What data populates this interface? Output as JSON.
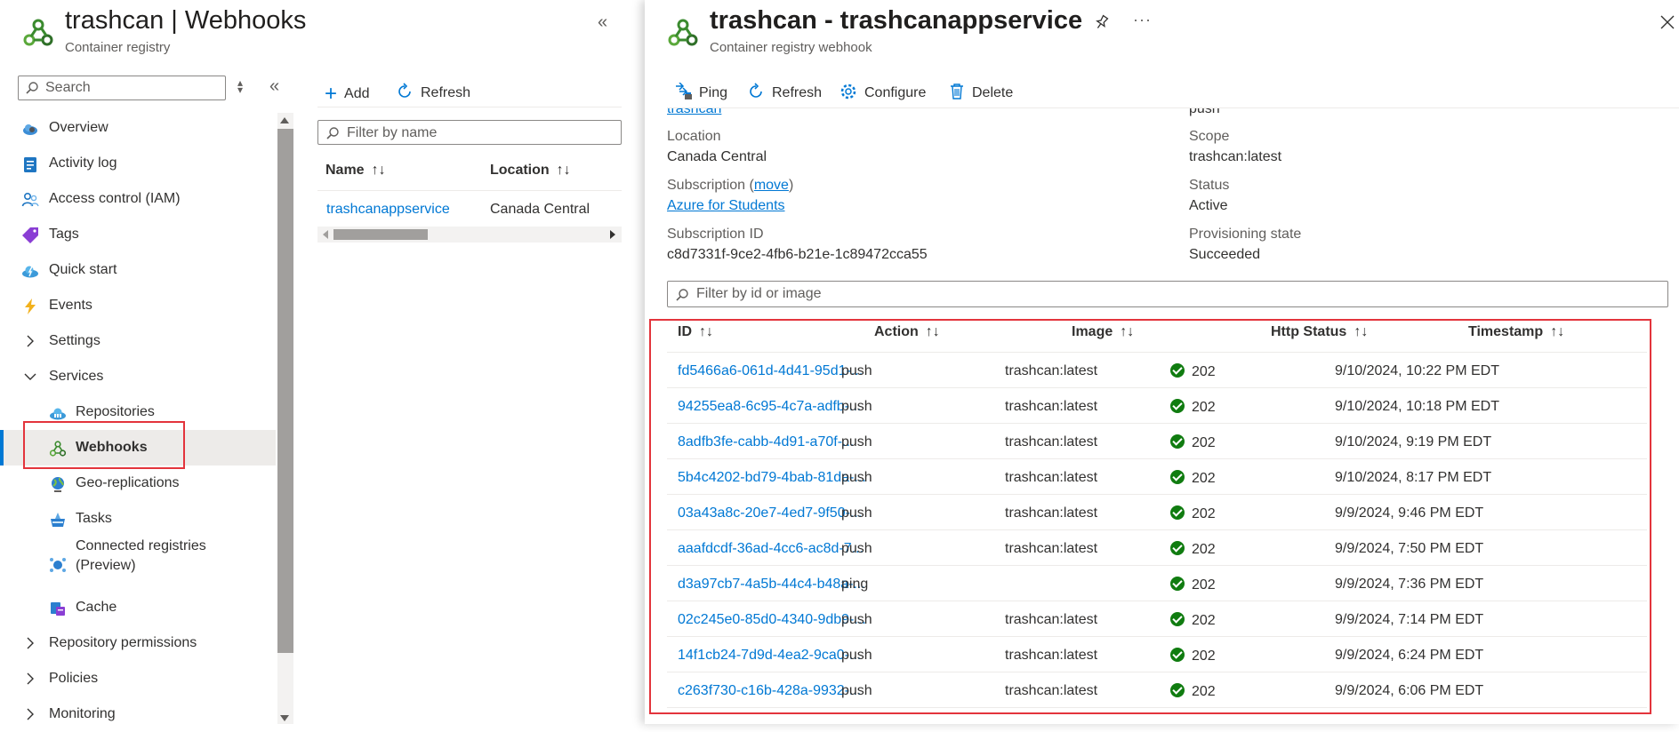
{
  "left_blade": {
    "title": "trashcan | Webhooks",
    "subtitle": "Container registry",
    "search_placeholder": "Search",
    "nav_items": [
      {
        "label": "Overview",
        "icon": "cloud-icon"
      },
      {
        "label": "Activity log",
        "icon": "activity-log-icon"
      },
      {
        "label": "Access control (IAM)",
        "icon": "people-icon"
      },
      {
        "label": "Tags",
        "icon": "tag-icon"
      },
      {
        "label": "Quick start",
        "icon": "quickstart-cloud-icon"
      },
      {
        "label": "Events",
        "icon": "lightning-icon"
      },
      {
        "label": "Settings",
        "icon": "chevron-right-icon"
      },
      {
        "label": "Services",
        "icon": "chevron-down-icon"
      },
      {
        "label": "Repositories",
        "icon": "repositories-cloud-icon"
      },
      {
        "label": "Webhooks",
        "icon": "webhook-icon",
        "selected": true
      },
      {
        "label": "Geo-replications",
        "icon": "globe-icon"
      },
      {
        "label": "Tasks",
        "icon": "tasks-icon"
      },
      {
        "label": "Connected registries",
        "label2": "(Preview)",
        "icon": "connected-registries-icon"
      },
      {
        "label": "Cache",
        "icon": "cache-icon"
      },
      {
        "label": "Repository permissions",
        "icon": "chevron-right-icon"
      },
      {
        "label": "Policies",
        "icon": "chevron-right-icon"
      },
      {
        "label": "Monitoring",
        "icon": "chevron-right-icon"
      }
    ]
  },
  "webhook_list": {
    "add_label": "Add",
    "refresh_label": "Refresh",
    "filter_placeholder": "Filter by name",
    "columns": [
      "Name",
      "Location"
    ],
    "rows": [
      {
        "name": "trashcanappservice",
        "location": "Canada Central"
      }
    ]
  },
  "detail_panel": {
    "title": "trashcan - trashcanappservice",
    "subtitle": "Container registry webhook",
    "toolbar": {
      "ping": "Ping",
      "refresh": "Refresh",
      "configure": "Configure",
      "delete": "Delete"
    },
    "properties": {
      "registry_link_partial": "trashcan",
      "actions_value_partial": "push",
      "location_label": "Location",
      "location_value": "Canada Central",
      "scope_label": "Scope",
      "scope_value": "trashcan:latest",
      "subscription_label_prefix": "Subscription (",
      "subscription_move_link": "move",
      "subscription_label_suffix": ")",
      "subscription_value": "Azure for Students",
      "status_label": "Status",
      "status_value": "Active",
      "subscription_id_label": "Subscription ID",
      "subscription_id_value": "c8d7331f-9ce2-4fb6-b21e-1c89472cca55",
      "provisioning_label": "Provisioning state",
      "provisioning_value": "Succeeded"
    },
    "events_filter_placeholder": "Filter by id or image",
    "events_columns": [
      "ID",
      "Action",
      "Image",
      "Http Status",
      "Timestamp"
    ],
    "events": [
      {
        "id": "fd5466a6-061d-4d41-95d1-...",
        "action": "push",
        "image": "trashcan:latest",
        "status": "202",
        "timestamp": "9/10/2024, 10:22 PM EDT"
      },
      {
        "id": "94255ea8-6c95-4c7a-adfb-...",
        "action": "push",
        "image": "trashcan:latest",
        "status": "202",
        "timestamp": "9/10/2024, 10:18 PM EDT"
      },
      {
        "id": "8adfb3fe-cabb-4d91-a70f-...",
        "action": "push",
        "image": "trashcan:latest",
        "status": "202",
        "timestamp": "9/10/2024, 9:19 PM EDT"
      },
      {
        "id": "5b4c4202-bd79-4bab-81da-...",
        "action": "push",
        "image": "trashcan:latest",
        "status": "202",
        "timestamp": "9/10/2024, 8:17 PM EDT"
      },
      {
        "id": "03a43a8c-20e7-4ed7-9f50-...",
        "action": "push",
        "image": "trashcan:latest",
        "status": "202",
        "timestamp": "9/9/2024, 9:46 PM EDT"
      },
      {
        "id": "aaafdcdf-36ad-4cc6-ac8d-7...",
        "action": "push",
        "image": "trashcan:latest",
        "status": "202",
        "timestamp": "9/9/2024, 7:50 PM EDT"
      },
      {
        "id": "d3a97cb7-4a5b-44c4-b48a-...",
        "action": "ping",
        "image": "",
        "status": "202",
        "timestamp": "9/9/2024, 7:36 PM EDT"
      },
      {
        "id": "02c245e0-85d0-4340-9db9-...",
        "action": "push",
        "image": "trashcan:latest",
        "status": "202",
        "timestamp": "9/9/2024, 7:14 PM EDT"
      },
      {
        "id": "14f1cb24-7d9d-4ea2-9ca0-...",
        "action": "push",
        "image": "trashcan:latest",
        "status": "202",
        "timestamp": "9/9/2024, 6:24 PM EDT"
      },
      {
        "id": "c263f730-c16b-428a-9932-...",
        "action": "push",
        "image": "trashcan:latest",
        "status": "202",
        "timestamp": "9/9/2024, 6:06 PM EDT"
      }
    ]
  },
  "colors": {
    "accent": "#0078d4",
    "highlight_border": "#e3343c",
    "success": "#107c10"
  }
}
